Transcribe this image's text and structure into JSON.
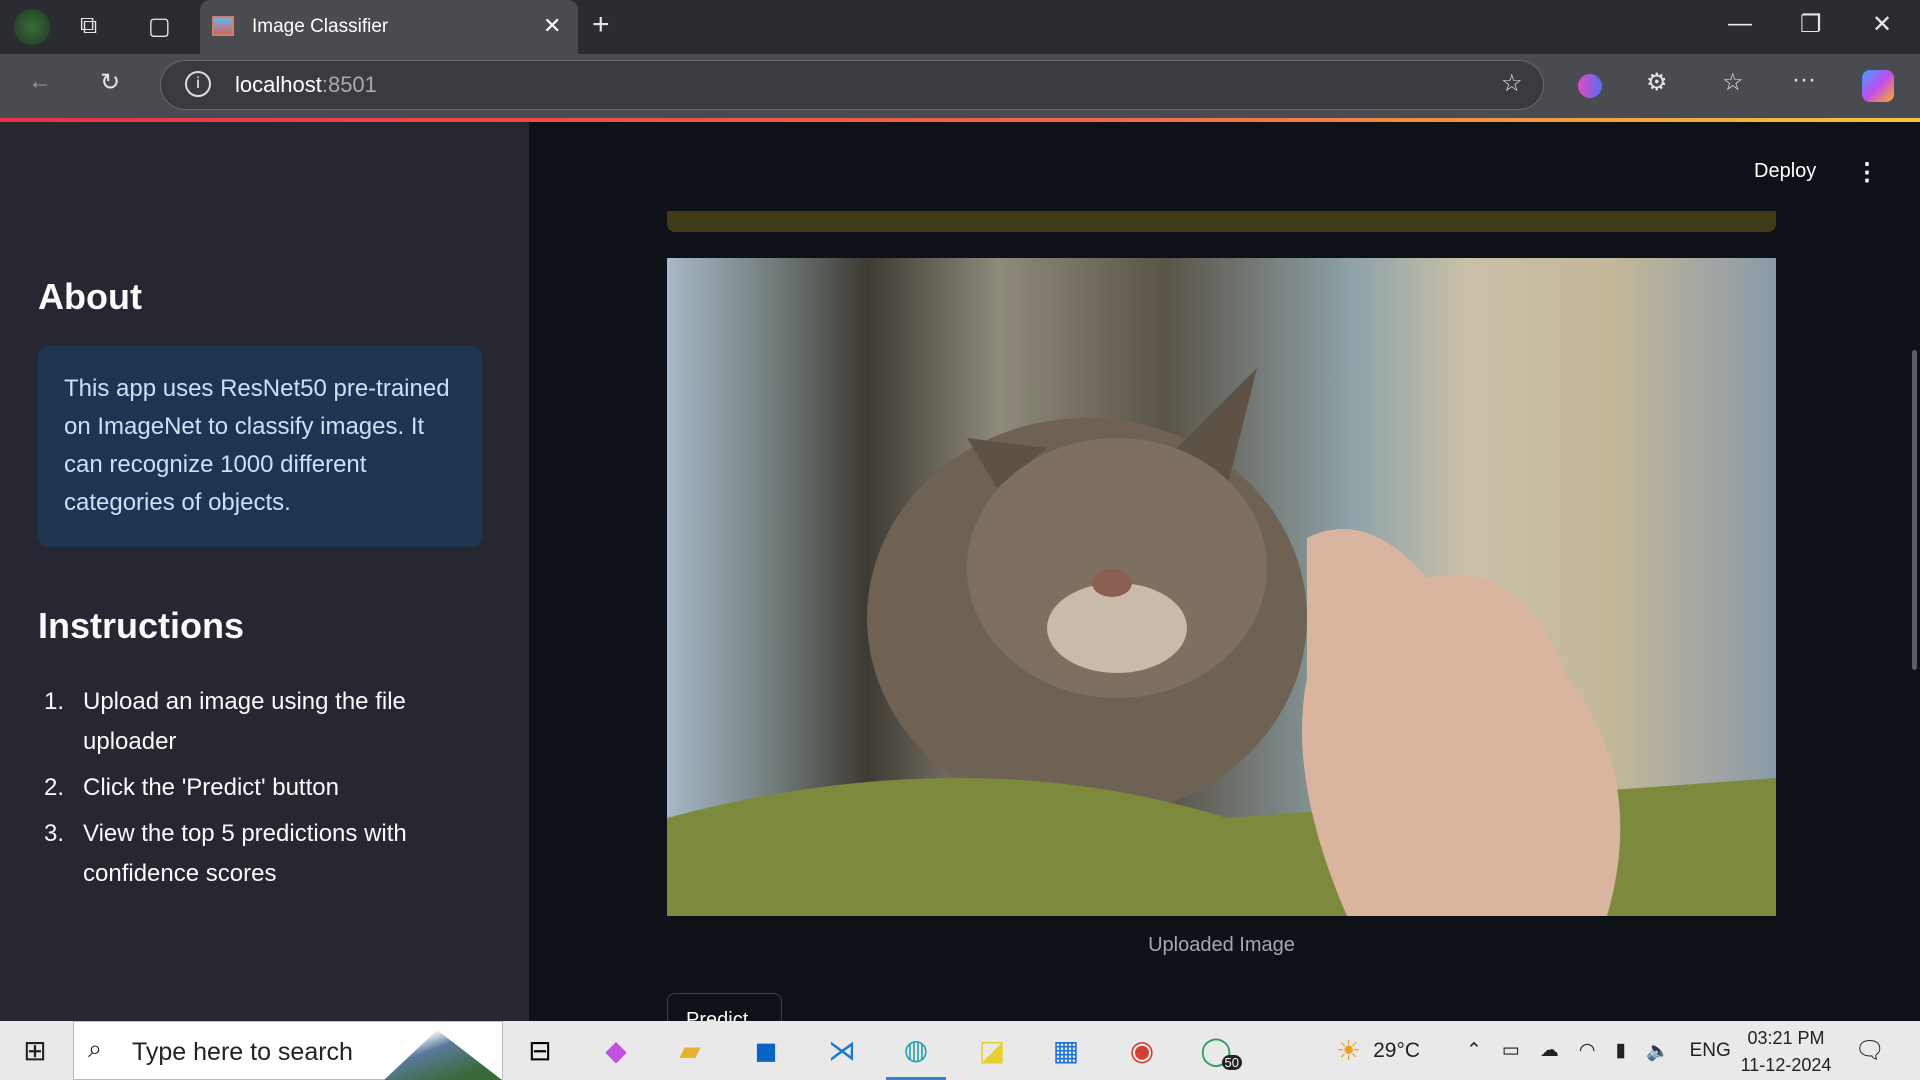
{
  "browser": {
    "tab_title": "Image Classifier",
    "url_host": "localhost",
    "url_port": ":8501"
  },
  "sidebar": {
    "about_title": "About",
    "about_text": "This app uses ResNet50 pre-trained on ImageNet to classify images. It can recognize 1000 different categories of objects.",
    "instructions_title": "Instructions",
    "instructions": [
      {
        "n": "1.",
        "text": "Upload an image using the file uploader"
      },
      {
        "n": "2.",
        "text": "Click the 'Predict' button"
      },
      {
        "n": "3.",
        "text": "View the top 5 predictions with confidence scores"
      }
    ]
  },
  "main": {
    "deploy_label": "Deploy",
    "image_caption": "Uploaded Image",
    "predict_label": "Predict"
  },
  "taskbar": {
    "search_placeholder": "Type here to search",
    "weather": "29°C",
    "language": "ENG",
    "time": "03:21 PM",
    "date": "11-12-2024",
    "whatsapp_badge": "50"
  },
  "colors": {
    "sidebar_bg": "#262730",
    "main_bg": "#0e1117",
    "info_bg": "#1e3550",
    "bar": "#3f3b18"
  }
}
